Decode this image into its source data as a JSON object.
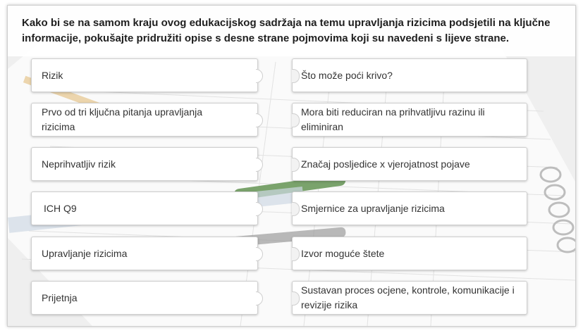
{
  "instruction": "Kako bi se na samom kraju ovog edukacijskog sadržaja na temu upravljanja rizicima podsjetili na ključne informacije, pokušajte pridružiti opise s desne strane pojmovima koji su navedeni s lijeve strane.",
  "terms": [
    "Rizik",
    "Prvo od tri ključna pitanja upravljanja rizicima",
    "Neprihvatljiv rizik",
    "ICH Q9",
    "Upravljanje rizicima",
    "Prijetnja"
  ],
  "descriptions": [
    "Što može poći krivo?",
    "Mora biti reduciran na prihvatljivu razinu ili eliminiran",
    "Značaj posljedice x vjerojatnost pojave",
    "Smjernice za upravljanje rizicima",
    "Izvor moguće štete",
    "Sustavan proces ocjene, kontrole, komunikacije i revizije rizika"
  ]
}
